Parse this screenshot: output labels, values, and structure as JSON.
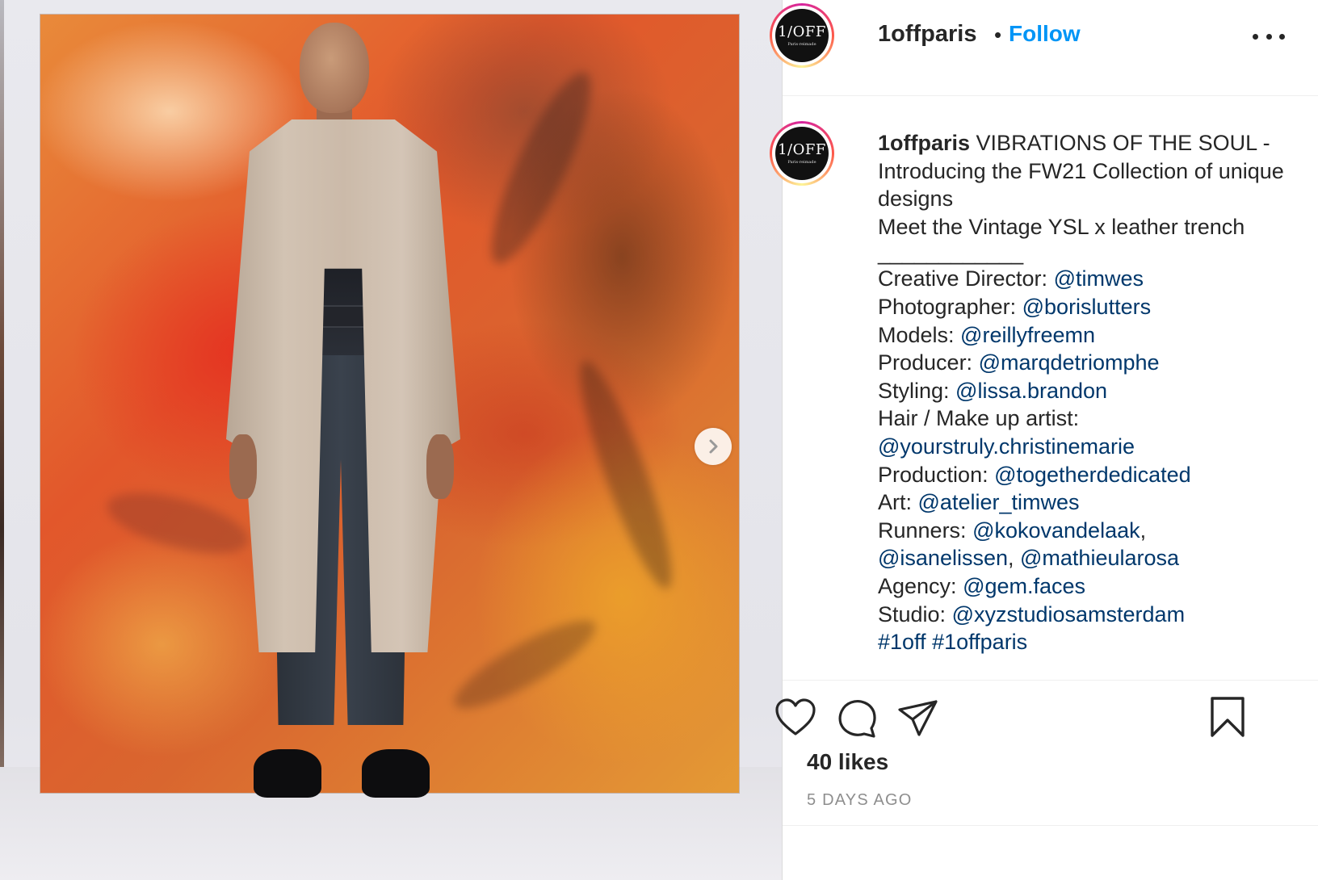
{
  "post": {
    "media_alt": "",
    "next_icon": "chevron-right-icon"
  },
  "header": {
    "avatar_logo": "1/OFF",
    "avatar_tag": "Paris·reimade",
    "username": "1offparis",
    "separator": "•",
    "follow_label": "Follow",
    "more_icon": "more-options-icon"
  },
  "caption": {
    "username": "1offparis",
    "intro": "VIBRATIONS OF THE SOUL - Introducing the FW21 Collection of unique designs",
    "line2": "Meet the Vintage YSL x leather trench",
    "rule": "____________",
    "credits": [
      {
        "label": "Creative Director: ",
        "mentions": [
          "@timwes"
        ]
      },
      {
        "label": "Photographer: ",
        "mentions": [
          "@borislutters"
        ]
      },
      {
        "label": "Models: ",
        "mentions": [
          "@reillyfreemn"
        ]
      },
      {
        "label": "Producer: ",
        "mentions": [
          "@marqdetriomphe"
        ]
      },
      {
        "label": "Styling: ",
        "mentions": [
          "@lissa.brandon"
        ]
      },
      {
        "label": "Hair / Make up artist: ",
        "mentions": [
          "@yourstruly.christinemarie"
        ]
      },
      {
        "label": "Production: ",
        "mentions": [
          "@togetherdedicated"
        ]
      },
      {
        "label": "Art: ",
        "mentions": [
          "@atelier_timwes"
        ]
      },
      {
        "label": "Runners: ",
        "mentions": [
          "@kokovandelaak",
          "@isanelissen",
          "@mathieularosa"
        ]
      },
      {
        "label": "Agency: ",
        "mentions": [
          "@gem.faces"
        ]
      },
      {
        "label": "Studio: ",
        "mentions": [
          "@xyzstudiosamsterdam"
        ]
      }
    ],
    "hashtags": [
      "#1off",
      "#1offparis"
    ]
  },
  "actions": {
    "like_icon": "heart-icon",
    "comment_icon": "comment-icon",
    "share_icon": "share-icon",
    "save_icon": "bookmark-icon"
  },
  "likes": "40 likes",
  "timestamp": "5 DAYS AGO"
}
